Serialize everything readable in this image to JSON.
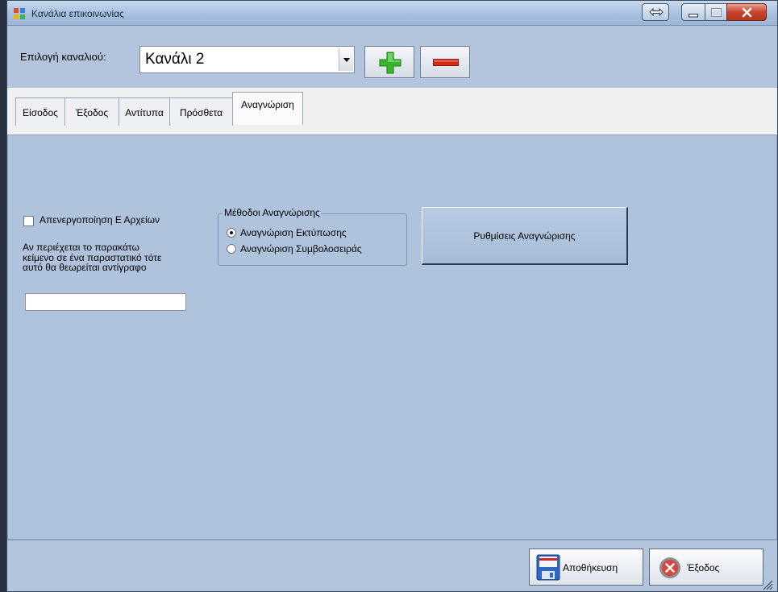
{
  "window": {
    "title": "Κανάλια επικοινωνίας"
  },
  "channel": {
    "label": "Επιλογή καναλιού:",
    "selected": "Κανάλι 2",
    "add_icon": "plus-icon",
    "remove_icon": "minus-icon"
  },
  "tabs": [
    {
      "label": "Είσοδος",
      "active": false
    },
    {
      "label": "Έξοδος",
      "active": false
    },
    {
      "label": "Αντίτυπα",
      "active": false
    },
    {
      "label": "Πρόσθετα",
      "active": false
    },
    {
      "label": "Αναγνώριση",
      "active": true
    }
  ],
  "recognition": {
    "disable_checkbox_label": "Απενεργοποίηση Ε Αρχείων",
    "disable_checked": false,
    "duplicate_hint_lines": [
      "Αν περιέχεται το παρακάτω",
      "κείμενο σε ένα παραστατικό τότε",
      "αυτό θα θεωρείται αντίγραφο"
    ],
    "duplicate_text_value": "",
    "methods_title": "Μέθοδοι Αναγνώρισης",
    "methods": [
      {
        "label": "Αναγνώριση Εκτύπωσης",
        "selected": true
      },
      {
        "label": "Αναγνώριση Συμβολοσειράς",
        "selected": false
      }
    ],
    "settings_button": "Ρυθμίσεις Αναγνώρισης"
  },
  "footer": {
    "save": "Αποθήκευση",
    "exit": "Έξοδος"
  },
  "colors": {
    "panel": "#afc3dd",
    "add_green": "#37b52b",
    "remove_red": "#d42a16"
  }
}
